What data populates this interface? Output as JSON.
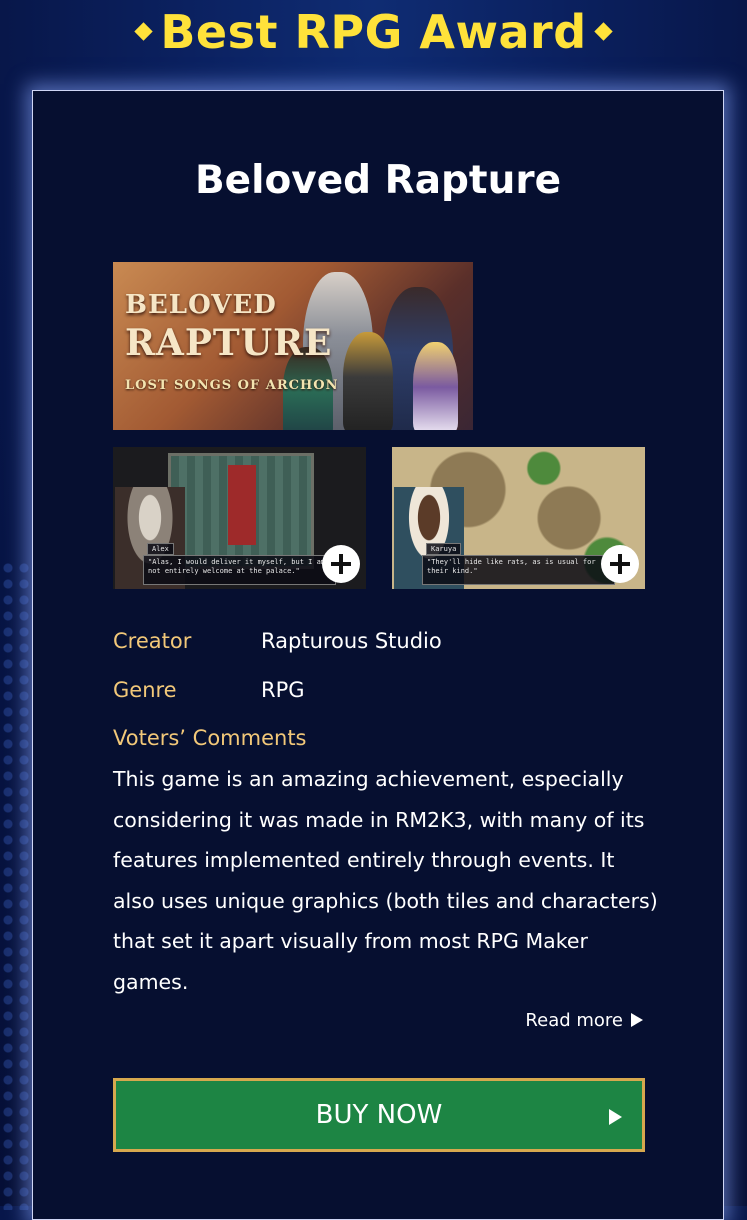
{
  "award": {
    "title": "Best RPG Award"
  },
  "game": {
    "title": "Beloved Rapture",
    "cover": {
      "logo_line1": "BELOVED",
      "logo_line2": "RAPTURE",
      "logo_sub": "LOST SONGS OF ARCHON"
    },
    "screenshots": [
      {
        "speaker": "Alex",
        "dialogue": "\"Alas, I would deliver it myself, but I am not entirely welcome at the palace.\""
      },
      {
        "speaker": "Karuya",
        "dialogue": "\"They'll hide like rats, as is usual for their kind.\""
      }
    ],
    "creator_label": "Creator",
    "creator": "Rapturous Studio",
    "genre_label": "Genre",
    "genre": "RPG",
    "comments_label": "Voters’ Comments",
    "comments": "This game is an amazing achievement, especially considering it was made in RM2K3, with many of its features implemented entirely through events. It also uses unique graphics (both tiles and characters) that set it apart visually from most RPG Maker games.",
    "read_more": "Read more",
    "buy_label": "BUY NOW"
  },
  "icons": {
    "award_decoration": "diamond-icon",
    "zoom": "plus-circle-icon",
    "read_more_arrow": "triangle-right-icon",
    "buy_arrow": "triangle-right-icon"
  },
  "colors": {
    "accent_yellow": "#ffe23a",
    "label_gold": "#f2c879",
    "buy_green": "#1d8544",
    "buy_border": "#d6a84e",
    "card_bg": "#060f30"
  }
}
